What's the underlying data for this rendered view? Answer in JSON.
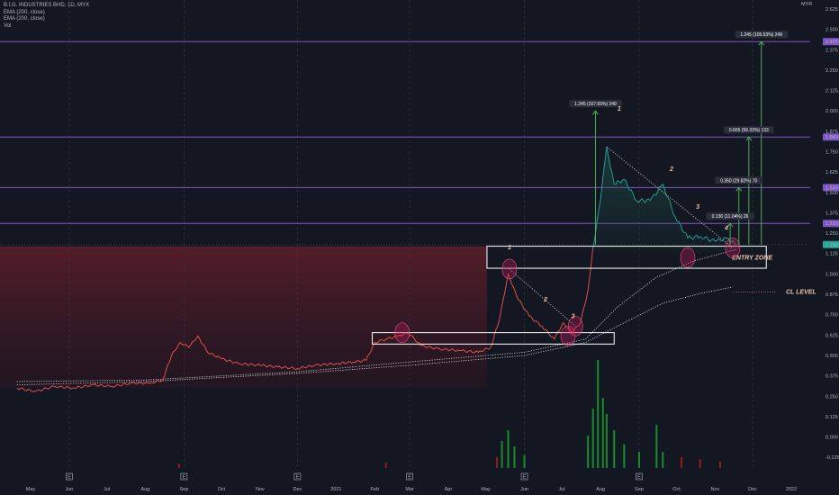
{
  "legend": {
    "title": "B.I.G. INDUSTRIES BHD, 1D, MYX",
    "ema1": "EMA (200, close)",
    "ema2": "EMA (200, close)",
    "vol": "Vol"
  },
  "currency": "MYR",
  "colors": {
    "bg": "#131722",
    "grid": "#2a2e39",
    "priceDown": "#f05454",
    "priceUp": "#26a69a",
    "level": "#7e57c2",
    "zone": "#ffffff",
    "circle": "#e0405a",
    "arrow": "#4caf50",
    "labelBg": "#2a2e39",
    "volUp": "#1b8a2e",
    "volDown": "#8b1f1f",
    "ema": "#d9d9d9",
    "handText": "#f0c4a8"
  },
  "chart_data": {
    "type": "line",
    "title": "B.I.G. INDUSTRIES BHD, 1D, MYX",
    "x_ticks": [
      "May",
      "Jun",
      "Jul",
      "Aug",
      "Sep",
      "Oct",
      "Nov",
      "Dec",
      "2021",
      "Feb",
      "Mar",
      "Apr",
      "May",
      "Jun",
      "Jul",
      "Aug",
      "Sep",
      "Oct",
      "Nov",
      "Dec",
      "2022"
    ],
    "y_ticks": [
      "2.625",
      "2.500",
      "2.375",
      "2.250",
      "2.125",
      "2.000",
      "1.875",
      "1.750",
      "1.625",
      "1.500",
      "1.375",
      "1.250",
      "1.125",
      "1.000",
      "0.875",
      "0.750",
      "0.625",
      "0.500",
      "0.375",
      "0.250",
      "0.125",
      "0.000",
      "-0.125"
    ],
    "y_range": [
      -0.19,
      2.68
    ],
    "price": {
      "name": "Close",
      "points": [
        [
          "2020-04-20",
          0.3
        ],
        [
          "2020-05-05",
          0.28
        ],
        [
          "2020-05-20",
          0.31
        ],
        [
          "2020-06-05",
          0.3
        ],
        [
          "2020-06-20",
          0.32
        ],
        [
          "2020-07-05",
          0.31
        ],
        [
          "2020-07-20",
          0.33
        ],
        [
          "2020-08-05",
          0.33
        ],
        [
          "2020-08-15",
          0.35
        ],
        [
          "2020-08-22",
          0.5
        ],
        [
          "2020-08-29",
          0.58
        ],
        [
          "2020-09-05",
          0.55
        ],
        [
          "2020-09-12",
          0.62
        ],
        [
          "2020-09-20",
          0.52
        ],
        [
          "2020-10-01",
          0.48
        ],
        [
          "2020-10-15",
          0.45
        ],
        [
          "2020-11-01",
          0.44
        ],
        [
          "2020-11-15",
          0.43
        ],
        [
          "2020-12-01",
          0.42
        ],
        [
          "2020-12-15",
          0.44
        ],
        [
          "2021-01-01",
          0.45
        ],
        [
          "2021-01-15",
          0.46
        ],
        [
          "2021-01-25",
          0.47
        ],
        [
          "2021-02-01",
          0.58
        ],
        [
          "2021-02-10",
          0.6
        ],
        [
          "2021-02-20",
          0.62
        ],
        [
          "2021-02-28",
          0.64
        ],
        [
          "2021-03-10",
          0.56
        ],
        [
          "2021-03-25",
          0.54
        ],
        [
          "2021-04-10",
          0.53
        ],
        [
          "2021-04-25",
          0.52
        ],
        [
          "2021-05-05",
          0.55
        ],
        [
          "2021-05-12",
          0.72
        ],
        [
          "2021-05-19",
          1.0
        ],
        [
          "2021-05-26",
          0.86
        ],
        [
          "2021-06-05",
          0.74
        ],
        [
          "2021-06-15",
          0.68
        ],
        [
          "2021-06-25",
          0.6
        ],
        [
          "2021-07-02",
          0.7
        ],
        [
          "2021-07-09",
          0.64
        ],
        [
          "2021-07-16",
          0.7
        ],
        [
          "2021-07-22",
          0.9
        ],
        [
          "2021-07-26",
          1.16
        ],
        [
          "2021-08-01",
          1.45
        ],
        [
          "2021-08-06",
          1.78
        ],
        [
          "2021-08-12",
          1.55
        ],
        [
          "2021-08-20",
          1.58
        ],
        [
          "2021-08-30",
          1.45
        ],
        [
          "2021-09-10",
          1.45
        ],
        [
          "2021-09-20",
          1.55
        ],
        [
          "2021-09-30",
          1.35
        ],
        [
          "2021-10-10",
          1.22
        ],
        [
          "2021-10-20",
          1.23
        ],
        [
          "2021-11-01",
          1.2
        ],
        [
          "2021-11-10",
          1.22
        ],
        [
          "2021-11-18",
          1.18
        ]
      ]
    },
    "ema_200": {
      "name": "EMA (200, close)",
      "points": [
        [
          "2020-04-20",
          0.34
        ],
        [
          "2020-08-01",
          0.35
        ],
        [
          "2020-12-01",
          0.4
        ],
        [
          "2021-03-01",
          0.46
        ],
        [
          "2021-06-01",
          0.52
        ],
        [
          "2021-07-20",
          0.6
        ],
        [
          "2021-08-15",
          0.8
        ],
        [
          "2021-09-15",
          0.98
        ],
        [
          "2021-10-15",
          1.08
        ],
        [
          "2021-11-18",
          1.15
        ]
      ]
    },
    "ema_200_b": {
      "name": "EMA (200, close)",
      "points": [
        [
          "2020-04-20",
          0.32
        ],
        [
          "2020-08-01",
          0.34
        ],
        [
          "2020-12-01",
          0.39
        ],
        [
          "2021-03-01",
          0.44
        ],
        [
          "2021-06-01",
          0.5
        ],
        [
          "2021-07-20",
          0.58
        ],
        [
          "2021-08-20",
          0.7
        ],
        [
          "2021-09-20",
          0.82
        ],
        [
          "2021-10-20",
          0.88
        ],
        [
          "2021-11-15",
          0.92
        ]
      ]
    },
    "volume": [
      [
        "2021-05-10",
        0.1
      ],
      [
        "2021-05-14",
        0.25
      ],
      [
        "2021-05-19",
        0.35
      ],
      [
        "2021-05-24",
        0.2
      ],
      [
        "2021-06-01",
        0.12
      ],
      [
        "2021-07-22",
        0.3
      ],
      [
        "2021-07-26",
        0.55
      ],
      [
        "2021-07-30",
        1.0
      ],
      [
        "2021-08-03",
        0.65
      ],
      [
        "2021-08-06",
        0.5
      ],
      [
        "2021-08-12",
        0.35
      ],
      [
        "2021-08-20",
        0.22
      ],
      [
        "2021-09-01",
        0.15
      ],
      [
        "2021-09-15",
        0.4
      ],
      [
        "2021-09-20",
        0.15
      ],
      [
        "2021-10-05",
        0.1
      ],
      [
        "2021-10-20",
        0.08
      ],
      [
        "2021-11-05",
        0.06
      ],
      [
        "2021-02-10",
        0.05
      ],
      [
        "2020-08-28",
        0.04
      ]
    ],
    "levels": [
      {
        "value": 2.425,
        "label": "2.425"
      },
      {
        "value": 1.84,
        "label": "1.840"
      },
      {
        "value": 1.53,
        "label": "1.530"
      },
      {
        "value": 1.31,
        "label": "1.310"
      }
    ],
    "current_price": {
      "value": 1.18,
      "label": "1.180"
    },
    "zones": [
      {
        "x0": "2021-05-02",
        "x1": "2021-12-12",
        "y0": 1.035,
        "y1": 1.17,
        "label": "ENTRY ZONE"
      },
      {
        "x0": "2021-01-30",
        "x1": "2021-08-12",
        "y0": 0.57,
        "y1": 0.64,
        "label": ""
      }
    ],
    "cl_level": {
      "value": 0.9,
      "label": "CL LEVEL"
    },
    "measurements": [
      {
        "date": "2021-07-28",
        "from": 1.18,
        "to": 2.0,
        "label": "1.245 (167.65%) 249"
      },
      {
        "date": "2021-12-08",
        "from": 1.18,
        "to": 2.425,
        "label": "1.245 (105.53%) 249"
      },
      {
        "date": "2021-11-28",
        "from": 1.18,
        "to": 1.84,
        "label": "0.665 (56.33%) 133"
      },
      {
        "date": "2021-11-20",
        "from": 1.18,
        "to": 1.53,
        "label": "0.350 (29.82%) 70"
      },
      {
        "date": "2021-11-13",
        "from": 1.18,
        "to": 1.31,
        "label": "0.130 (11.04%) 26"
      }
    ],
    "wave_labels": [
      {
        "date": "2021-05-20",
        "value": 1.15,
        "text": "1"
      },
      {
        "date": "2021-06-18",
        "value": 0.83,
        "text": "2"
      },
      {
        "date": "2021-07-10",
        "value": 0.73,
        "text": "3"
      },
      {
        "date": "2021-08-16",
        "value": 2.0,
        "text": "1"
      },
      {
        "date": "2021-09-27",
        "value": 1.63,
        "text": "2"
      },
      {
        "date": "2021-10-18",
        "value": 1.4,
        "text": "3"
      },
      {
        "date": "2021-11-10",
        "value": 1.27,
        "text": "4"
      }
    ],
    "circles": [
      {
        "date": "2021-02-23",
        "value": 0.64
      },
      {
        "date": "2021-05-20",
        "value": 1.03
      },
      {
        "date": "2021-07-06",
        "value": 0.62
      },
      {
        "date": "2021-07-12",
        "value": 0.68
      },
      {
        "date": "2021-10-10",
        "value": 1.1
      },
      {
        "date": "2021-11-15",
        "value": 1.16
      }
    ],
    "trendlines": [
      {
        "d0": "2021-05-20",
        "v0": 1.03,
        "d1": "2021-07-12",
        "v1": 0.68
      },
      {
        "d0": "2021-08-06",
        "v0": 1.78,
        "d1": "2021-11-15",
        "v1": 1.16
      }
    ],
    "event_markers": [
      "E",
      "E",
      "E",
      "E",
      "E",
      "E"
    ]
  }
}
